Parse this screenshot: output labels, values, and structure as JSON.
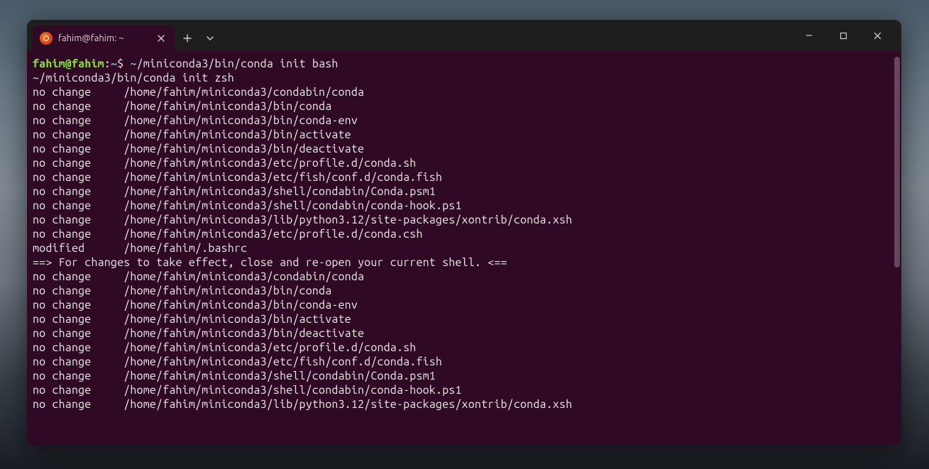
{
  "tab": {
    "title": "fahim@fahim: ~"
  },
  "prompt": {
    "user_host": "fahim@fahim",
    "colon": ":",
    "path": "~",
    "dollar": "$"
  },
  "command": "~/miniconda3/bin/conda init bash",
  "lines": {
    "l01": "~/miniconda3/bin/conda init zsh",
    "l02": "no change     /home/fahim/miniconda3/condabin/conda",
    "l03": "no change     /home/fahim/miniconda3/bin/conda",
    "l04": "no change     /home/fahim/miniconda3/bin/conda-env",
    "l05": "no change     /home/fahim/miniconda3/bin/activate",
    "l06": "no change     /home/fahim/miniconda3/bin/deactivate",
    "l07": "no change     /home/fahim/miniconda3/etc/profile.d/conda.sh",
    "l08": "no change     /home/fahim/miniconda3/etc/fish/conf.d/conda.fish",
    "l09": "no change     /home/fahim/miniconda3/shell/condabin/Conda.psm1",
    "l10": "no change     /home/fahim/miniconda3/shell/condabin/conda-hook.ps1",
    "l11": "no change     /home/fahim/miniconda3/lib/python3.12/site-packages/xontrib/conda.xsh",
    "l12": "no change     /home/fahim/miniconda3/etc/profile.d/conda.csh",
    "l13": "modified      /home/fahim/.bashrc",
    "l14": "",
    "l15": "==> For changes to take effect, close and re-open your current shell. <==",
    "l16": "",
    "l17": "no change     /home/fahim/miniconda3/condabin/conda",
    "l18": "no change     /home/fahim/miniconda3/bin/conda",
    "l19": "no change     /home/fahim/miniconda3/bin/conda-env",
    "l20": "no change     /home/fahim/miniconda3/bin/activate",
    "l21": "no change     /home/fahim/miniconda3/bin/deactivate",
    "l22": "no change     /home/fahim/miniconda3/etc/profile.d/conda.sh",
    "l23": "no change     /home/fahim/miniconda3/etc/fish/conf.d/conda.fish",
    "l24": "no change     /home/fahim/miniconda3/shell/condabin/Conda.psm1",
    "l25": "no change     /home/fahim/miniconda3/shell/condabin/conda-hook.ps1",
    "l26": "no change     /home/fahim/miniconda3/lib/python3.12/site-packages/xontrib/conda.xsh"
  }
}
